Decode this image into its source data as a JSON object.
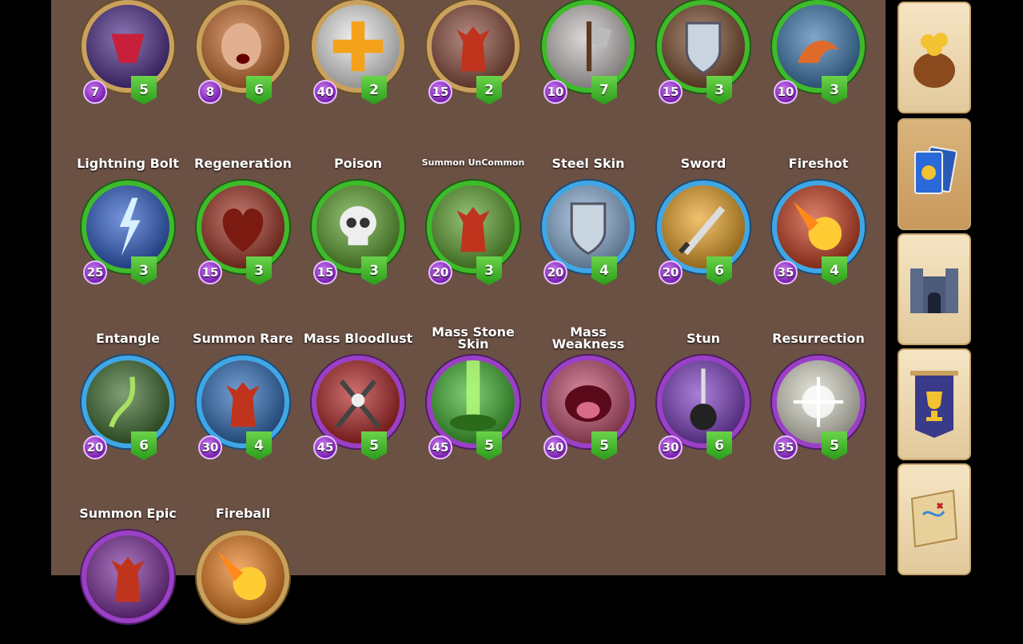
{
  "spells": [
    {
      "name": "",
      "mana": "7",
      "level": "5",
      "ring": "gold",
      "icon": "dark-rune-icon",
      "color": "#4b2a8a"
    },
    {
      "name": "",
      "mana": "8",
      "level": "6",
      "ring": "gold",
      "icon": "screaming-head-icon",
      "color": "#c96a2a"
    },
    {
      "name": "",
      "mana": "40",
      "level": "2",
      "ring": "gold",
      "icon": "healing-cross-icon",
      "color": "#e8e8e8"
    },
    {
      "name": "",
      "mana": "15",
      "level": "2",
      "ring": "gold",
      "icon": "summon-demon-icon",
      "color": "#8a4a3a"
    },
    {
      "name": "",
      "mana": "10",
      "level": "7",
      "ring": "green",
      "icon": "bloody-axe-icon",
      "color": "#c8c0c0"
    },
    {
      "name": "",
      "mana": "15",
      "level": "3",
      "ring": "green",
      "icon": "wooden-shield-icon",
      "color": "#7a4a2a"
    },
    {
      "name": "",
      "mana": "10",
      "level": "3",
      "ring": "green",
      "icon": "sea-monster-icon",
      "color": "#3a78b0"
    },
    {
      "name": "Lightning Bolt",
      "mana": "25",
      "level": "3",
      "ring": "green",
      "icon": "lightning-bolt-icon",
      "color": "#2a5ac8"
    },
    {
      "name": "Regeneration",
      "mana": "15",
      "level": "3",
      "ring": "green",
      "icon": "heart-icon",
      "color": "#a03020"
    },
    {
      "name": "Poison",
      "mana": "15",
      "level": "3",
      "ring": "green",
      "icon": "skull-icon",
      "color": "#5aa02a"
    },
    {
      "name": "Summon UnCommon",
      "mana": "20",
      "level": "3",
      "ring": "green",
      "icon": "summon-demon-icon",
      "color": "#5aa02a"
    },
    {
      "name": "Steel Skin",
      "mana": "20",
      "level": "4",
      "ring": "blue",
      "icon": "steel-shield-icon",
      "color": "#8ab0d8"
    },
    {
      "name": "Sword",
      "mana": "20",
      "level": "6",
      "ring": "blue",
      "icon": "flaming-sword-icon",
      "color": "#e8a020"
    },
    {
      "name": "Fireshot",
      "mana": "35",
      "level": "4",
      "ring": "blue",
      "icon": "fireball-icon",
      "color": "#c83a1a"
    },
    {
      "name": "Entangle",
      "mana": "20",
      "level": "6",
      "ring": "blue",
      "icon": "vines-icon",
      "color": "#3a6a2a"
    },
    {
      "name": "Summon Rare",
      "mana": "30",
      "level": "4",
      "ring": "blue",
      "icon": "summon-demon-icon",
      "color": "#2a6ab8"
    },
    {
      "name": "Mass Bloodlust",
      "mana": "45",
      "level": "5",
      "ring": "purple",
      "icon": "crossed-axes-icon",
      "color": "#b02020"
    },
    {
      "name": "Mass Stone Skin",
      "mana": "45",
      "level": "5",
      "ring": "purple",
      "icon": "green-beam-icon",
      "color": "#3ab02a"
    },
    {
      "name": "Mass Weakness",
      "mana": "40",
      "level": "5",
      "ring": "purple",
      "icon": "screaming-mouth-icon",
      "color": "#c04a6a"
    },
    {
      "name": "Stun",
      "mana": "30",
      "level": "6",
      "ring": "purple",
      "icon": "ball-and-chain-icon",
      "color": "#7a3ac0"
    },
    {
      "name": "Resurrection",
      "mana": "35",
      "level": "5",
      "ring": "purple",
      "icon": "light-burst-icon",
      "color": "#d8d8c8"
    },
    {
      "name": "Summon Epic",
      "mana": "",
      "level": "",
      "ring": "purple",
      "icon": "summon-demon-icon",
      "color": "#7a2a9a"
    },
    {
      "name": "Fireball",
      "mana": "",
      "level": "",
      "ring": "gold",
      "icon": "fireball-icon",
      "color": "#e87a1a"
    }
  ],
  "sidebar": [
    {
      "name": "treasure-bag-button",
      "icon": "gold-bag-icon",
      "active": false
    },
    {
      "name": "cards-button",
      "icon": "card-deck-icon",
      "active": true
    },
    {
      "name": "castle-button",
      "icon": "castle-icon",
      "active": false
    },
    {
      "name": "trophy-banner-button",
      "icon": "trophy-banner-icon",
      "active": false
    },
    {
      "name": "map-button",
      "icon": "treasure-map-icon",
      "active": false
    }
  ]
}
